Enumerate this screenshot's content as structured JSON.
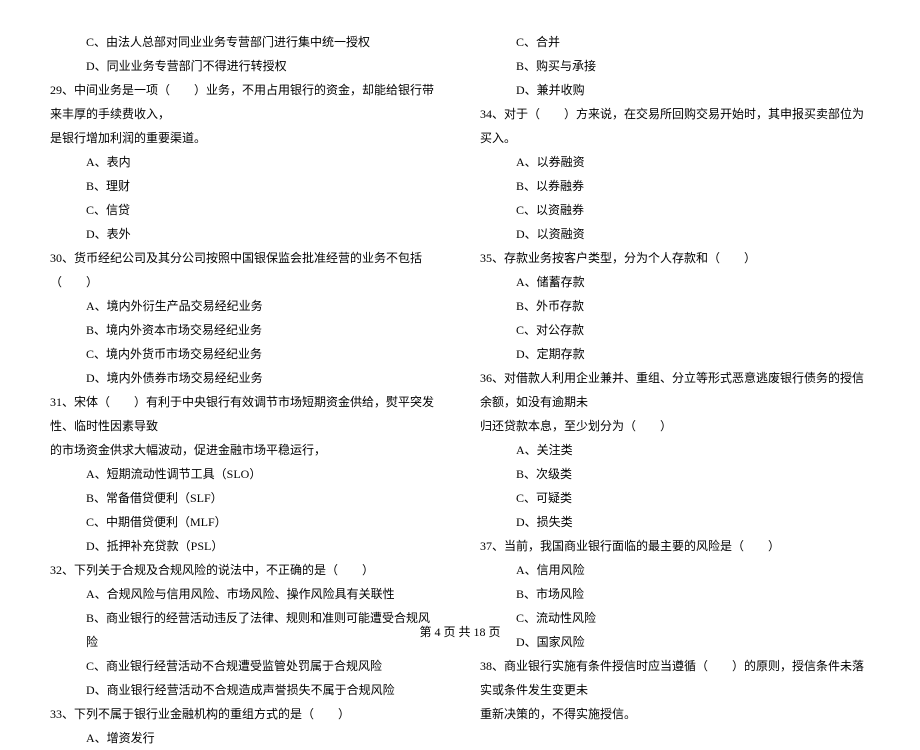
{
  "left": {
    "q28": {
      "c": "C、由法人总部对同业业务专营部门进行集中统一授权",
      "d": "D、同业业务专营部门不得进行转授权"
    },
    "q29": {
      "stem": "29、中间业务是一项（　　）业务，不用占用银行的资金，却能给银行带来丰厚的手续费收入，",
      "stem2": "是银行增加利润的重要渠道。",
      "a": "A、表内",
      "b": "B、理财",
      "c": "C、信贷",
      "d": "D、表外"
    },
    "q30": {
      "stem": "30、货币经纪公司及其分公司按照中国银保监会批准经营的业务不包括（　　）",
      "a": "A、境内外衍生产品交易经纪业务",
      "b": "B、境内外资本市场交易经纪业务",
      "c": "C、境内外货币市场交易经纪业务",
      "d": "D、境内外债券市场交易经纪业务"
    },
    "q31": {
      "stem": "31、宋体（　　）有利于中央银行有效调节市场短期资金供给，熨平突发性、临时性因素导致",
      "stem2": "的市场资金供求大幅波动，促进金融市场平稳运行，",
      "a": "A、短期流动性调节工具（SLO）",
      "b": "B、常备借贷便利（SLF）",
      "c": "C、中期借贷便利（MLF）",
      "d": "D、抵押补充贷款（PSL）"
    },
    "q32": {
      "stem": "32、下列关于合规及合规风险的说法中，不正确的是（　　）",
      "a": "A、合规风险与信用风险、市场风险、操作风险具有关联性",
      "b": "B、商业银行的经营活动违反了法律、规则和准则可能遭受合规风险",
      "c": "C、商业银行经营活动不合规遭受监管处罚属于合规风险",
      "d": "D、商业银行经营活动不合规造成声誉损失不属于合规风险"
    },
    "q33": {
      "stem": "33、下列不属于银行业金融机构的重组方式的是（　　）",
      "a": "A、增资发行"
    }
  },
  "right": {
    "q33": {
      "c": "C、合并",
      "b": "B、购买与承接",
      "d": "D、兼并收购"
    },
    "q34": {
      "stem": "34、对于（　　）方来说，在交易所回购交易开始时，其申报买卖部位为买入。",
      "a": "A、以券融资",
      "b": "B、以券融券",
      "c": "C、以资融券",
      "d": "D、以资融资"
    },
    "q35": {
      "stem": "35、存款业务按客户类型，分为个人存款和（　　）",
      "a": "A、储蓄存款",
      "b": "B、外币存款",
      "c": "C、对公存款",
      "d": "D、定期存款"
    },
    "q36": {
      "stem": "36、对借款人利用企业兼并、重组、分立等形式恶意逃废银行债务的授信余额，如没有逾期未",
      "stem2": "归还贷款本息，至少划分为（　　）",
      "a": "A、关注类",
      "b": "B、次级类",
      "c": "C、可疑类",
      "d": "D、损失类"
    },
    "q37": {
      "stem": "37、当前，我国商业银行面临的最主要的风险是（　　）",
      "a": "A、信用风险",
      "b": "B、市场风险",
      "c": "C、流动性风险",
      "d": "D、国家风险"
    },
    "q38": {
      "stem": "38、商业银行实施有条件授信时应当遵循（　　）的原则，授信条件未落实或条件发生变更未",
      "stem2": "重新决策的，不得实施授信。"
    }
  },
  "footer": "第 4 页 共 18 页"
}
